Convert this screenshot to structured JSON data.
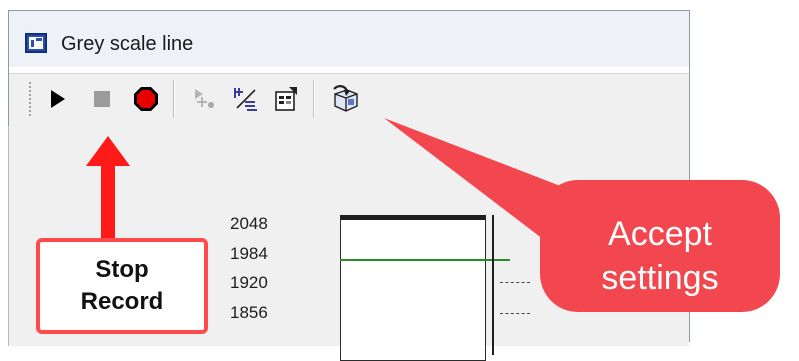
{
  "window": {
    "title": "Grey scale line"
  },
  "toolbar": {
    "buttons": [
      {
        "name": "play-icon",
        "label": "Play"
      },
      {
        "name": "stop-icon",
        "label": "Stop"
      },
      {
        "name": "record-icon",
        "label": "Record"
      },
      {
        "name": "add-marker-icon",
        "label": "Add"
      },
      {
        "name": "scale-icon",
        "label": "Scale"
      },
      {
        "name": "properties-icon",
        "label": "Properties"
      },
      {
        "name": "accept-settings-icon",
        "label": "Accept"
      }
    ]
  },
  "plot": {
    "y_ticks": [
      "2048",
      "1984",
      "1920",
      "1856"
    ]
  },
  "annotations": {
    "stop_record": [
      "Stop",
      "Record"
    ],
    "accept_settings": [
      "Accept",
      "settings"
    ]
  },
  "colors": {
    "callout": "#f3474f",
    "arrow": "#ff1a1a",
    "plot_line": "#2a8a2a"
  }
}
